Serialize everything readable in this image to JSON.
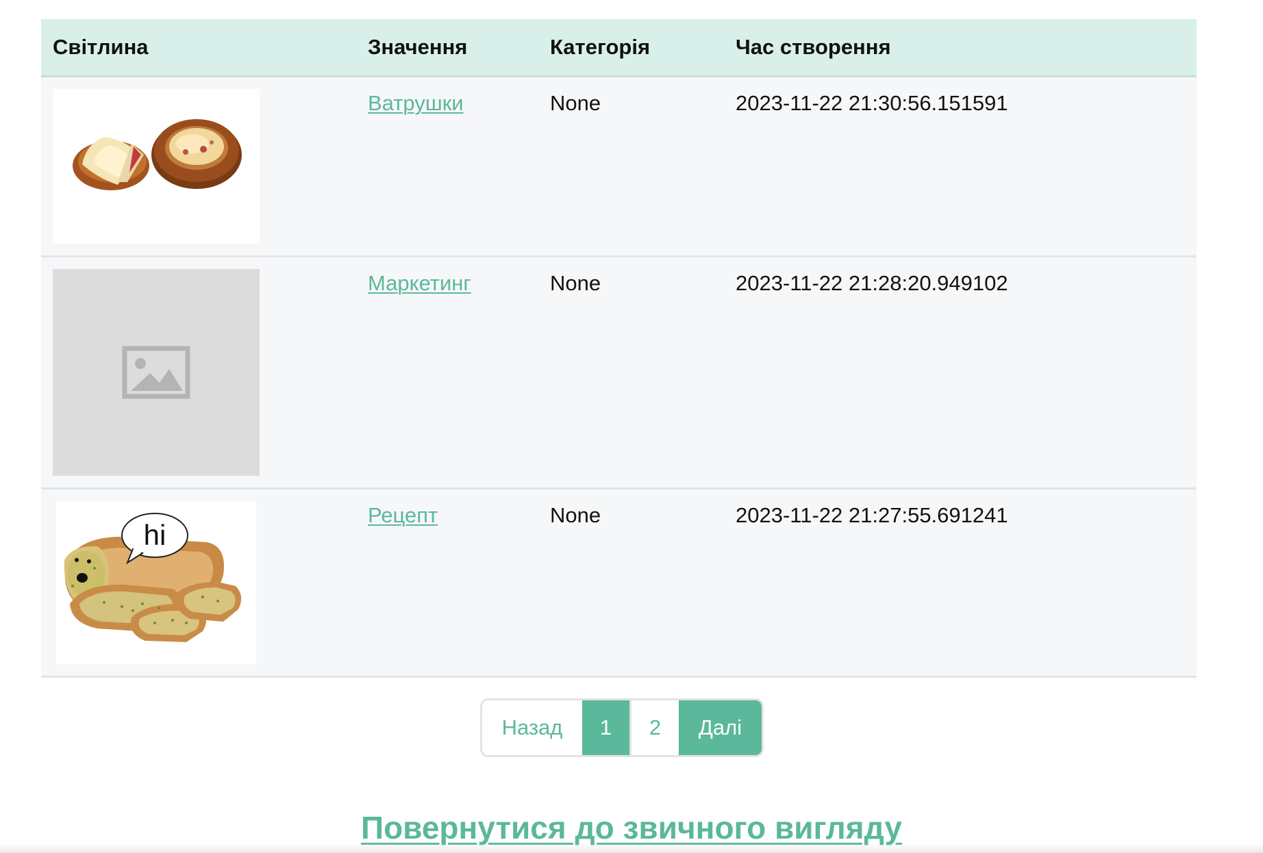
{
  "table": {
    "headers": {
      "photo": "Світлина",
      "value": "Значення",
      "category": "Категорія",
      "created": "Час створення"
    },
    "rows": [
      {
        "photo_icon": "vatrushka-photo",
        "value": "Ватрушки",
        "category": "None",
        "created": "2023-11-22 21:30:56.151591"
      },
      {
        "photo_icon": "image-placeholder-icon",
        "value": "Маркетинг",
        "category": "None",
        "created": "2023-11-22 21:28:20.949102"
      },
      {
        "photo_icon": "garlic-bread-photo",
        "photo_caption": "hi",
        "value": "Рецепт",
        "category": "None",
        "created": "2023-11-22 21:27:55.691241"
      }
    ]
  },
  "pagination": {
    "prev_label": "Назад",
    "pages": [
      "1",
      "2"
    ],
    "current_page": "1",
    "next_label": "Далі"
  },
  "back_link": "Повернутися до звичного вигляду",
  "colors": {
    "accent": "#5bb89a",
    "header_bg": "#d8f0e9",
    "row_bg": "#f6f7f9"
  }
}
